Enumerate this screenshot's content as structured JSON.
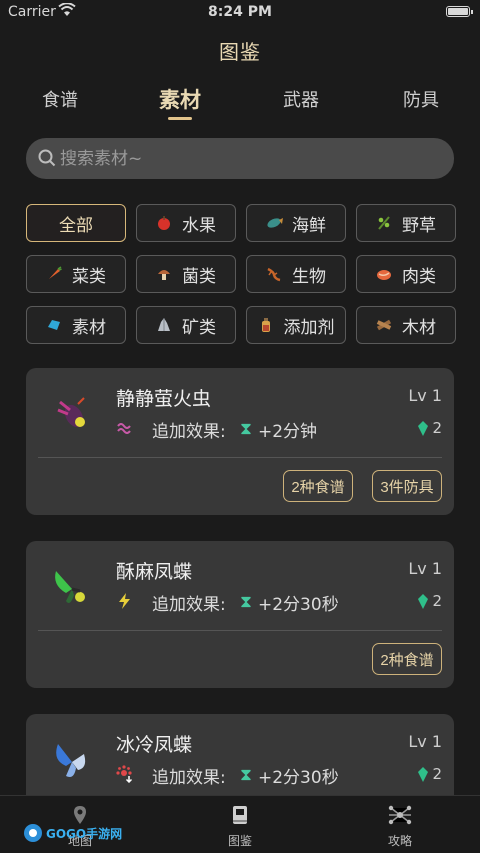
{
  "status": {
    "carrier": "Carrier",
    "time": "8:24 PM"
  },
  "title": "图鉴",
  "tabs": [
    {
      "label": "食谱"
    },
    {
      "label": "素材",
      "active": true
    },
    {
      "label": "武器"
    },
    {
      "label": "防具"
    }
  ],
  "search": {
    "placeholder": "搜索素材~"
  },
  "filters": [
    {
      "label": "全部",
      "icon": "none",
      "active": true
    },
    {
      "label": "水果",
      "icon": "apple-icon"
    },
    {
      "label": "海鲜",
      "icon": "fish-icon"
    },
    {
      "label": "野草",
      "icon": "herb-icon"
    },
    {
      "label": "菜类",
      "icon": "carrot-icon"
    },
    {
      "label": "菌类",
      "icon": "mushroom-icon"
    },
    {
      "label": "生物",
      "icon": "lizard-icon"
    },
    {
      "label": "肉类",
      "icon": "meat-icon"
    },
    {
      "label": "素材",
      "icon": "crystal-icon"
    },
    {
      "label": "矿类",
      "icon": "ore-icon"
    },
    {
      "label": "添加剂",
      "icon": "bottle-icon"
    },
    {
      "label": "木材",
      "icon": "wood-icon"
    }
  ],
  "cards": [
    {
      "name": "静静萤火虫",
      "level": "Lv 1",
      "effect_label": "追加效果:",
      "effect_value": "+2分钟",
      "effect_icon": "stealth-icon",
      "gem_count": "2",
      "buttons": [
        "2种食谱",
        "3件防具"
      ]
    },
    {
      "name": "酥麻凤蝶",
      "level": "Lv 1",
      "effect_label": "追加效果:",
      "effect_value": "+2分30秒",
      "effect_icon": "lightning-icon",
      "gem_count": "2",
      "buttons": [
        "2种食谱"
      ]
    },
    {
      "name": "冰冷凤蝶",
      "level": "Lv 1",
      "effect_label": "追加效果:",
      "effect_value": "+2分30秒",
      "effect_icon": "heat-resist-icon",
      "gem_count": "2",
      "buttons": []
    }
  ],
  "bottom_nav": [
    {
      "label": "地图",
      "icon": "map-icon"
    },
    {
      "label": "图鉴",
      "icon": "book-icon",
      "active": true
    },
    {
      "label": "攻略",
      "icon": "network-icon"
    }
  ],
  "watermark": "GOGO手游网",
  "colors": {
    "accent": "#e2c48c",
    "effect_green": "#45c9a0",
    "card_bg": "#383838"
  }
}
